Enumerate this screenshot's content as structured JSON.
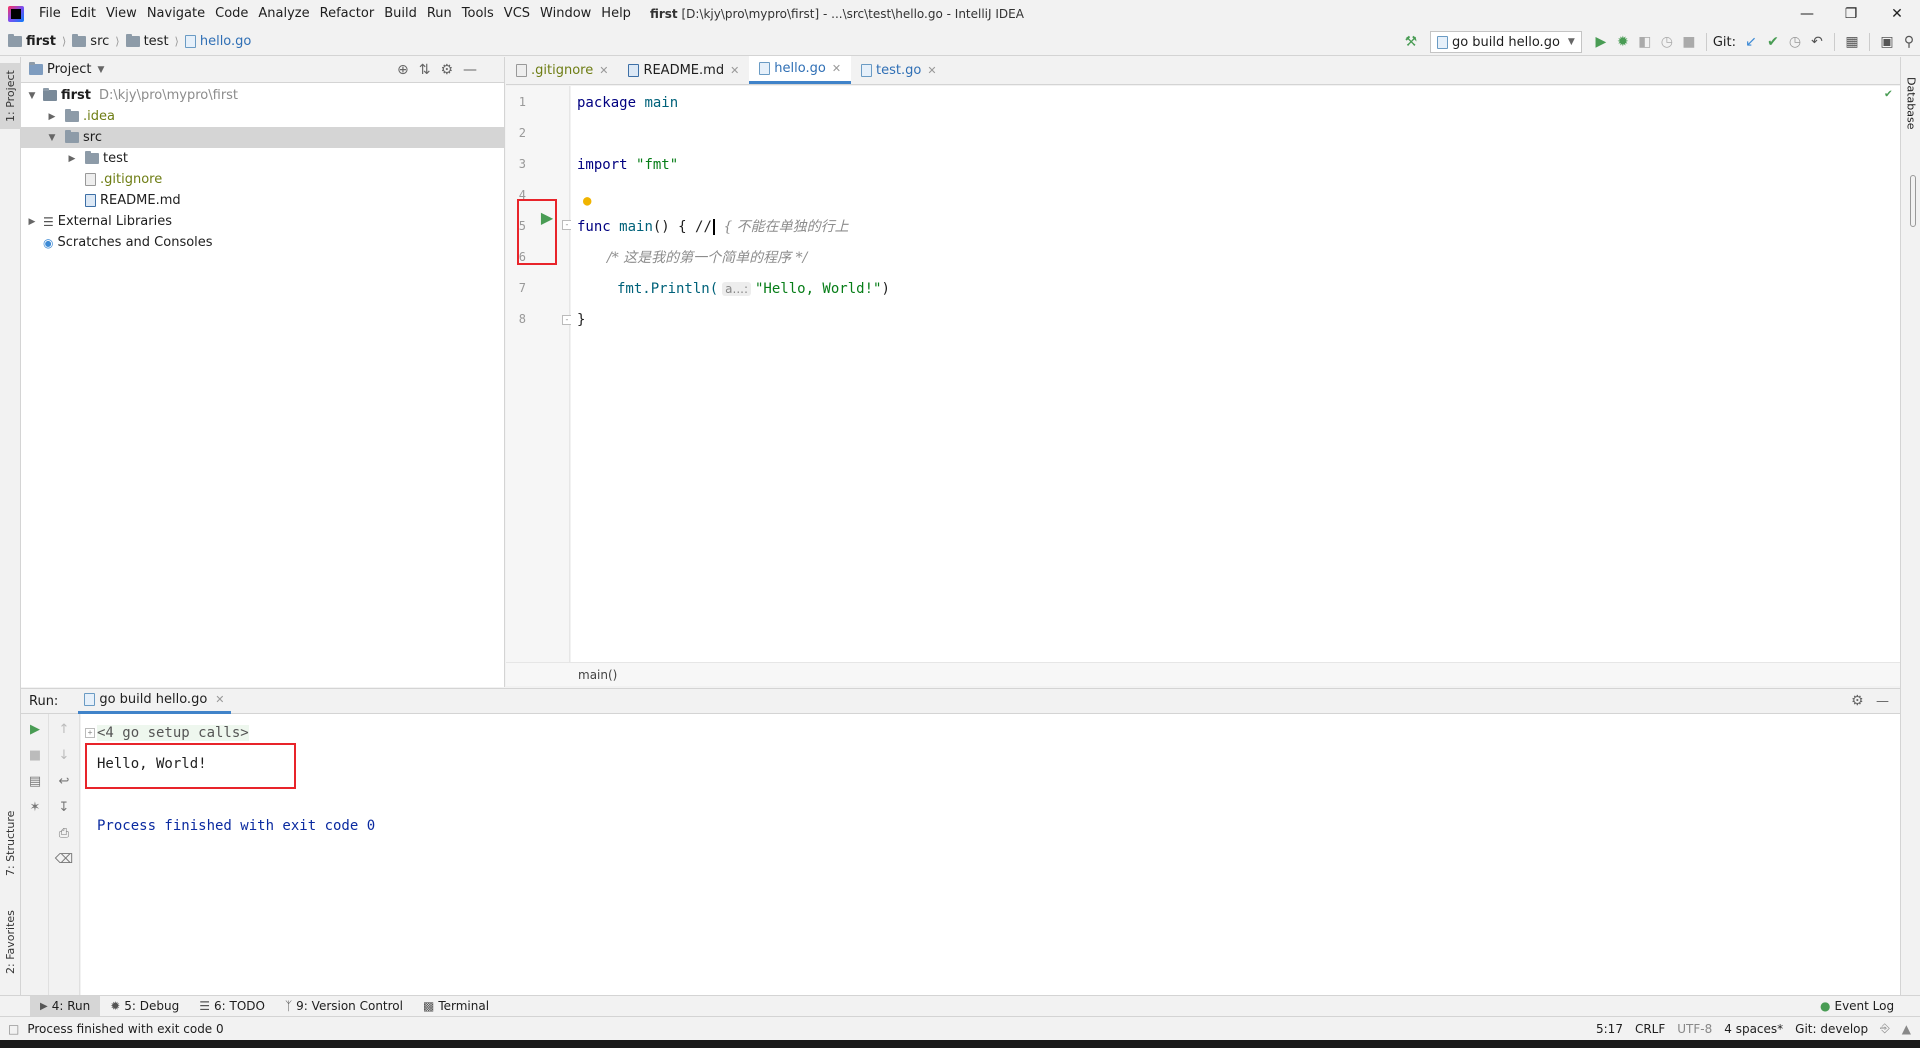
{
  "window": {
    "title_bold": "first",
    "title_rest": "[D:\\kjy\\pro\\mypro\\first] - ...\\src\\test\\hello.go - IntelliJ IDEA"
  },
  "menu": [
    "File",
    "Edit",
    "View",
    "Navigate",
    "Code",
    "Analyze",
    "Refactor",
    "Build",
    "Run",
    "Tools",
    "VCS",
    "Window",
    "Help"
  ],
  "breadcrumbs": [
    "first",
    "src",
    "test",
    "hello.go"
  ],
  "toolbar": {
    "run_config": "go build hello.go",
    "git_label": "Git:"
  },
  "project_panel": {
    "title": "Project",
    "tree": [
      {
        "label": "first",
        "hint": "D:\\kjy\\pro\\mypro\\first"
      },
      {
        "label": ".idea"
      },
      {
        "label": "src"
      },
      {
        "label": "test"
      },
      {
        "label": ".gitignore"
      },
      {
        "label": "README.md"
      },
      {
        "label": "External Libraries"
      },
      {
        "label": "Scratches and Consoles"
      }
    ]
  },
  "editor": {
    "tabs": [
      ".gitignore",
      "README.md",
      "hello.go",
      "test.go"
    ],
    "active_tab": "hello.go",
    "line_numbers": [
      "1",
      "2",
      "3",
      "4",
      "5",
      "6",
      "7",
      "8"
    ],
    "code": {
      "l1_kw": "package",
      "l1_name": "main",
      "l3_kw": "import",
      "l3_str": "\"fmt\"",
      "l5_kw": "func",
      "l5_fn": "main",
      "l5_rest": "() { //",
      "l5_cmt": "{ 不能在单独的行上",
      "l6_cmt": "/* 这是我的第一个简单的程序 */",
      "l7_pre": "fmt.Println(",
      "l7_hint": "a...:",
      "l7_str": "\"Hello, World!\"",
      "l7_post": ")",
      "l8": "}"
    },
    "breadcrumb": "main()"
  },
  "run_panel": {
    "label": "Run:",
    "tab": "go build hello.go",
    "console": {
      "setup": "<4 go setup calls>",
      "output": "Hello, World!",
      "finished": "Process finished with exit code 0"
    }
  },
  "side_tabs": {
    "left": [
      "1: Project",
      "7: Structure",
      "2: Favorites"
    ],
    "right": [
      "Database"
    ]
  },
  "bottom_tabs": [
    "4: Run",
    "5: Debug",
    "6: TODO",
    "9: Version Control",
    "Terminal"
  ],
  "event_log": "Event Log",
  "status": {
    "message": "Process finished with exit code 0",
    "position": "5:17",
    "line_sep": "CRLF",
    "encoding": "UTF-8",
    "indent": "4 spaces*",
    "git_branch": "Git: develop"
  },
  "colors": {
    "accent": "#4083c9",
    "run_green": "#499c54",
    "highlight_red": "#e8242a",
    "console_blue": "#0a2aa0"
  }
}
